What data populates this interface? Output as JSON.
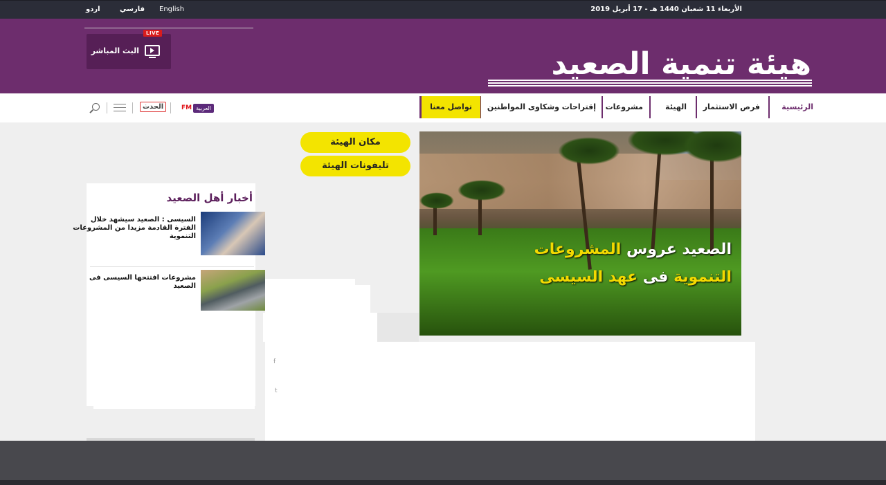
{
  "topbar": {
    "date": "الأربعاء 11 شعبان 1440 هـ - 17 أبريل 2019",
    "languages": [
      "English",
      "فارسي",
      "اردو"
    ]
  },
  "header": {
    "logo_text": "هيئة تنمية الصعيد",
    "live_badge": "LIVE",
    "live_label": "البث المباشر"
  },
  "nav": {
    "items": [
      "الرئيسية",
      "فرص الاستثمار",
      "الهيئة",
      "مشروعات",
      "إقتراحات وشكاوى المواطنين"
    ],
    "contact": "تواصل معنا",
    "partner_fm": "FM",
    "partner_arabia": "العربية",
    "partner_hadath": "الحدث"
  },
  "buttons": {
    "location": "مكان الهيئة",
    "phones": "تليفونات الهيئة"
  },
  "hero": {
    "line1_part1": "الصعيد عروس ",
    "line1_part2": "المشروعات",
    "line2_part1": "التنموية ",
    "line2_part2": "فى ",
    "line2_part3": "عهد السيسى"
  },
  "news": {
    "title": "أخبار أهل الصعيد",
    "items": [
      {
        "text": "السيسى :     الصعيد سيشهد خلال الفترة القادمة مزيدا من المشروعات التنموية"
      },
      {
        "text": "مشروعات افتتحها السيسى فى الصعيد"
      }
    ]
  },
  "colors": {
    "brand_purple": "#6d2d6d",
    "accent_yellow": "#f3e400",
    "topbar": "#2b2d38",
    "footer": "#48484d"
  },
  "icons": [
    "tv-icon",
    "hamburger-icon",
    "search-icon"
  ]
}
